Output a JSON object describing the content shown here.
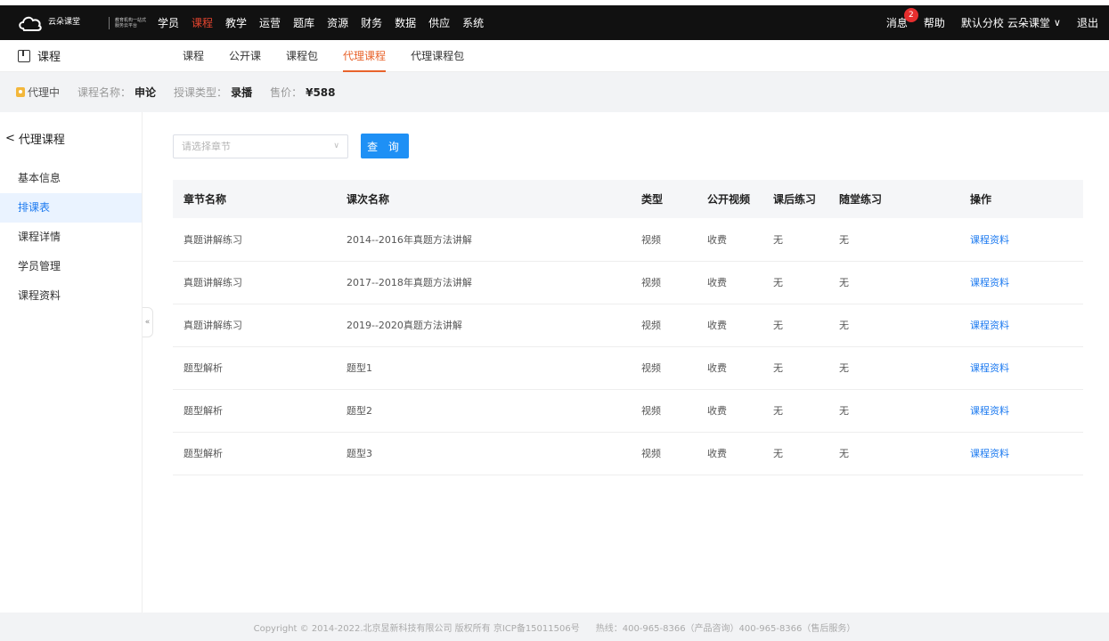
{
  "logo": {
    "text": "云朵课堂",
    "sub": "教育机构一站式服务云平台"
  },
  "topnav": [
    "学员",
    "课程",
    "教学",
    "运营",
    "题库",
    "资源",
    "财务",
    "数据",
    "供应",
    "系统"
  ],
  "topnav_active": "课程",
  "topright": {
    "messages": "消息",
    "message_count": "2",
    "help": "帮助",
    "school": "默认分校",
    "org": "云朵课堂",
    "logout": "退出"
  },
  "subbar": {
    "title": "课程",
    "tabs": [
      "课程",
      "公开课",
      "课程包",
      "代理课程",
      "代理课程包"
    ],
    "active": "代理课程"
  },
  "infobar": {
    "status": "代理中",
    "course_label": "课程名称：",
    "course": "申论",
    "type_label": "授课类型：",
    "type": "录播",
    "price_label": "售价：",
    "price": "¥588"
  },
  "left": {
    "back": "代理课程",
    "items": [
      "基本信息",
      "排课表",
      "课程详情",
      "学员管理",
      "课程资料"
    ],
    "active": "排课表",
    "collapse": "«"
  },
  "filter": {
    "placeholder": "请选择章节",
    "button": "查 询"
  },
  "table": {
    "headers": [
      "章节名称",
      "课次名称",
      "类型",
      "公开视频",
      "课后练习",
      "随堂练习",
      "操作"
    ],
    "rows": [
      [
        "真题讲解练习",
        "2014--2016年真题方法讲解",
        "视频",
        "收费",
        "无",
        "无",
        "课程资料"
      ],
      [
        "真题讲解练习",
        "2017--2018年真题方法讲解",
        "视频",
        "收费",
        "无",
        "无",
        "课程资料"
      ],
      [
        "真题讲解练习",
        "2019--2020真题方法讲解",
        "视频",
        "收费",
        "无",
        "无",
        "课程资料"
      ],
      [
        "题型解析",
        "题型1",
        "视频",
        "收费",
        "无",
        "无",
        "课程资料"
      ],
      [
        "题型解析",
        "题型2",
        "视频",
        "收费",
        "无",
        "无",
        "课程资料"
      ],
      [
        "题型解析",
        "题型3",
        "视频",
        "收费",
        "无",
        "无",
        "课程资料"
      ]
    ]
  },
  "footer": {
    "copyright": "Copyright © 2014-2022.北京昱新科技有限公司 版权所有 京ICP备15011506号",
    "hotline": "热线：400-965-8366（产品咨询）400-965-8366（售后服务）"
  },
  "colors": {
    "active_nav": "#e6452f",
    "active_tab": "#e8632b",
    "link": "#1e7bf0",
    "button": "#1e90f5"
  }
}
